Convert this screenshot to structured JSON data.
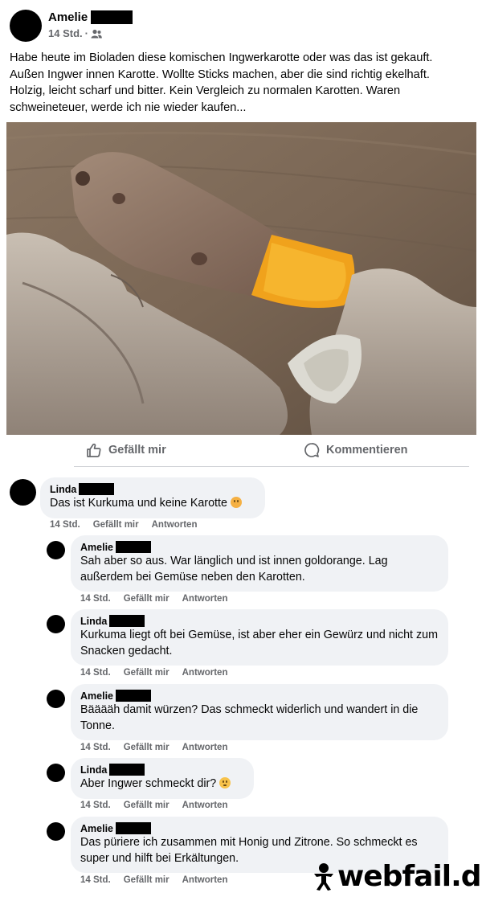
{
  "post": {
    "author": "Amelie",
    "time": "14 Std.",
    "audience_icon": "friends-icon",
    "text": "Habe heute im Bioladen diese komischen Ingwerkarotte oder was das ist gekauft. Außen Ingwer innen Karotte. Wollte Sticks machen, aber die sind richtig ekelhaft. Holzig, leicht scharf und bitter. Kein Vergleich zu normalen Karotten. Waren schweineteuer, werde ich nie wieder kaufen..."
  },
  "actions": {
    "like_label": "Gefällt mir",
    "comment_label": "Kommentieren"
  },
  "comments": [
    {
      "author": "Linda",
      "text": "Das ist Kurkuma und keine Karotte",
      "emoji": "flushed-face",
      "time": "14 Std.",
      "like": "Gefällt mir",
      "reply": "Antworten"
    },
    {
      "author": "Amelie",
      "text": "Sah aber so aus. War länglich und ist innen goldorange. Lag außerdem bei Gemüse neben den Karotten.",
      "time": "14 Std.",
      "like": "Gefällt mir",
      "reply": "Antworten"
    },
    {
      "author": "Linda",
      "text": "Kurkuma liegt oft bei Gemüse, ist aber eher ein Gewürz und nicht zum Snacken gedacht.",
      "time": "14 Std.",
      "like": "Gefällt mir",
      "reply": "Antworten"
    },
    {
      "author": "Amelie",
      "text": "Bääääh damit würzen? Das schmeckt widerlich und wandert in die Tonne.",
      "time": "14 Std.",
      "like": "Gefällt mir",
      "reply": "Antworten"
    },
    {
      "author": "Linda",
      "text": "Aber Ingwer schmeckt dir?",
      "emoji": "confused-face",
      "time": "14 Std.",
      "like": "Gefällt mir",
      "reply": "Antworten"
    },
    {
      "author": "Amelie",
      "text": "Das püriere ich zusammen mit Honig und Zitrone. So schmeckt es super und hilft bei Erkältungen.",
      "time": "14 Std.",
      "like": "Gefällt mir",
      "reply": "Antworten"
    }
  ],
  "watermark": "webfail.de",
  "colors": {
    "meta": "#65676b",
    "bubble": "#f0f2f5",
    "divider": "#ced0d4"
  }
}
